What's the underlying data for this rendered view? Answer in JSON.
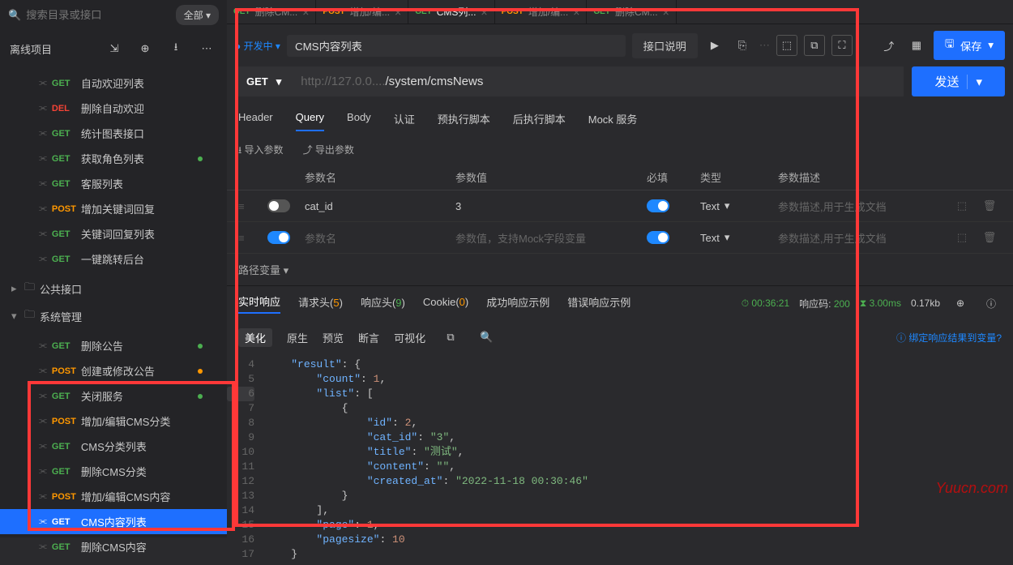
{
  "search": {
    "placeholder": "搜索目录或接口",
    "filter": "全部"
  },
  "projectHeader": "离线项目",
  "sidebarFolders": {
    "public": "公共接口",
    "system": "系统管理"
  },
  "sidebarItems": [
    {
      "method": "GET",
      "mClass": "m-get",
      "label": "自动欢迎列表"
    },
    {
      "method": "DEL",
      "mClass": "m-del",
      "label": "删除自动欢迎"
    },
    {
      "method": "GET",
      "mClass": "m-get",
      "label": "统计图表接口"
    },
    {
      "method": "GET",
      "mClass": "m-get",
      "label": "获取角色列表",
      "dot": "green"
    },
    {
      "method": "GET",
      "mClass": "m-get",
      "label": "客服列表"
    },
    {
      "method": "POST",
      "mClass": "m-post",
      "label": "增加关键词回复"
    },
    {
      "method": "GET",
      "mClass": "m-get",
      "label": "关键词回复列表"
    },
    {
      "method": "GET",
      "mClass": "m-get",
      "label": "一键跳转后台"
    }
  ],
  "systemItems": [
    {
      "method": "GET",
      "mClass": "m-get",
      "label": "删除公告",
      "dot": "green"
    },
    {
      "method": "POST",
      "mClass": "m-post",
      "label": "创建或修改公告",
      "dot": "orange"
    },
    {
      "method": "GET",
      "mClass": "m-get",
      "label": "关闭服务",
      "dot": "green"
    },
    {
      "method": "POST",
      "mClass": "m-post",
      "label": "增加/编辑CMS分类"
    },
    {
      "method": "GET",
      "mClass": "m-get",
      "label": "CMS分类列表"
    },
    {
      "method": "GET",
      "mClass": "m-get",
      "label": "删除CMS分类"
    },
    {
      "method": "POST",
      "mClass": "m-post",
      "label": "增加/编辑CMS内容"
    },
    {
      "method": "GET",
      "mClass": "m-get",
      "label": "CMS内容列表",
      "active": true
    },
    {
      "method": "GET",
      "mClass": "m-get",
      "label": "删除CMS内容"
    }
  ],
  "topTabs": [
    {
      "method": "GET",
      "mClass": "m-get",
      "label": "删除CM..."
    },
    {
      "method": "POST",
      "mClass": "m-post",
      "label": "增加/编..."
    },
    {
      "method": "GET",
      "mClass": "m-get",
      "label": "CMS列...",
      "active": true
    },
    {
      "method": "POST",
      "mClass": "m-post",
      "label": "增加/编..."
    },
    {
      "method": "GET",
      "mClass": "m-get",
      "label": "删除CM..."
    }
  ],
  "request": {
    "status": "● 开发中 ▾",
    "title": "CMS内容列表",
    "desc": "接口说明",
    "save": "保存",
    "method": "GET",
    "urlPrefix": "http://127.0.0....",
    "urlPath": "/system/cmsNews",
    "send": "发送"
  },
  "reqTabs": [
    "Header",
    "Query",
    "Body",
    "认证",
    "预执行脚本",
    "后执行脚本",
    "Mock 服务"
  ],
  "reqTabActive": 1,
  "paramActions": {
    "import": "导入参数",
    "export": "导出参数"
  },
  "paramHead": {
    "name": "参数名",
    "value": "参数值",
    "required": "必填",
    "type": "类型",
    "desc": "参数描述"
  },
  "paramRows": [
    {
      "on": false,
      "name": "cat_id",
      "value": "3",
      "reqOn": true,
      "type": "Text",
      "descPh": "参数描述,用于生成文档"
    },
    {
      "on": true,
      "namePh": "参数名",
      "valuePh": "参数值，支持Mock字段变量",
      "reqOn": true,
      "type": "Text",
      "descPh": "参数描述,用于生成文档"
    }
  ],
  "pathVar": "路径变量",
  "respTabs": [
    {
      "label": "实时响应",
      "active": true
    },
    {
      "label": "请求头",
      "count": "5",
      "cClass": "badge-warn"
    },
    {
      "label": "响应头",
      "count": "9",
      "cClass": "meta-code"
    },
    {
      "label": "Cookie",
      "count": "0",
      "cClass": "badge-warn"
    },
    {
      "label": "成功响应示例"
    },
    {
      "label": "错误响应示例"
    }
  ],
  "respMeta": {
    "clock": "00:36:21",
    "codeLabel": "响应码:",
    "code": "200",
    "dur": "3.00ms",
    "size": "0.17kb"
  },
  "respToolbar": [
    "美化",
    "原生",
    "预览",
    "断言",
    "可视化"
  ],
  "bindLink": "绑定响应结果到变量?",
  "jsonLines": [
    {
      "ln": 4,
      "indent": 2,
      "raw": "\"result\": {"
    },
    {
      "ln": 5,
      "indent": 4,
      "raw": "\"count\": 1,"
    },
    {
      "ln": 6,
      "indent": 4,
      "raw": "\"list\": [",
      "active": true
    },
    {
      "ln": 7,
      "indent": 6,
      "raw": "{"
    },
    {
      "ln": 8,
      "indent": 8,
      "raw": "\"id\": 2,"
    },
    {
      "ln": 9,
      "indent": 8,
      "raw": "\"cat_id\": \"3\","
    },
    {
      "ln": 10,
      "indent": 8,
      "raw": "\"title\": \"测试\","
    },
    {
      "ln": 11,
      "indent": 8,
      "raw": "\"content\": \"\","
    },
    {
      "ln": 12,
      "indent": 8,
      "raw": "\"created_at\": \"2022-11-18 00:30:46\""
    },
    {
      "ln": 13,
      "indent": 6,
      "raw": "}"
    },
    {
      "ln": 14,
      "indent": 4,
      "raw": "],"
    },
    {
      "ln": 15,
      "indent": 4,
      "raw": "\"page\": 1,"
    },
    {
      "ln": 16,
      "indent": 4,
      "raw": "\"pagesize\": 10"
    },
    {
      "ln": 17,
      "indent": 2,
      "raw": "}"
    }
  ],
  "watermark": "Yuucn.com"
}
